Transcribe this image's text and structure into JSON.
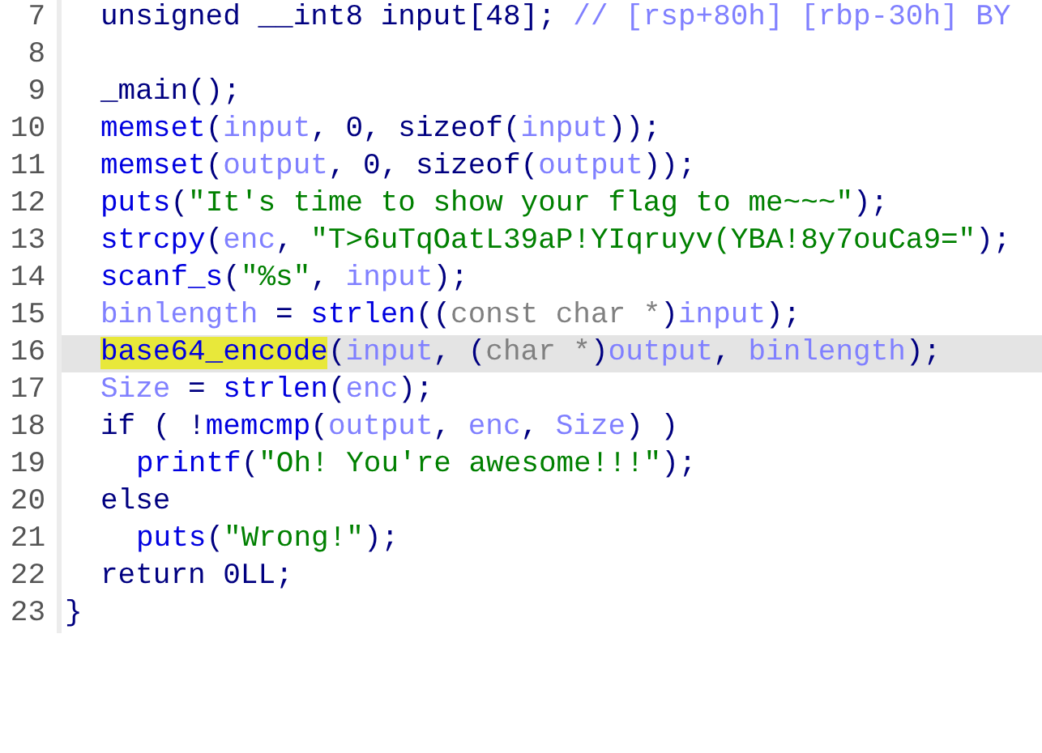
{
  "code_view": {
    "lines": [
      {
        "number": "7",
        "kind": "body",
        "current": false,
        "tokens": [
          {
            "kind": "plain",
            "text": "unsigned __int8 input[48]; "
          },
          {
            "kind": "comment",
            "text": "// [rsp+80h] [rbp-30h] BY"
          }
        ]
      },
      {
        "number": "8",
        "kind": "body",
        "current": false
      },
      {
        "number": "9",
        "kind": "body",
        "current": false,
        "tokens": [
          {
            "kind": "plain",
            "text": "_main();"
          }
        ]
      },
      {
        "number": "10",
        "kind": "body",
        "current": false,
        "tokens": [
          {
            "kind": "func",
            "text": "memset"
          },
          {
            "kind": "plain",
            "text": "("
          },
          {
            "kind": "var",
            "text": "input"
          },
          {
            "kind": "plain",
            "text": ", 0, sizeof("
          },
          {
            "kind": "var",
            "text": "input"
          },
          {
            "kind": "plain",
            "text": "));"
          }
        ]
      },
      {
        "number": "11",
        "kind": "body",
        "current": false,
        "tokens": [
          {
            "kind": "func",
            "text": "memset"
          },
          {
            "kind": "plain",
            "text": "("
          },
          {
            "kind": "var",
            "text": "output"
          },
          {
            "kind": "plain",
            "text": ", 0, sizeof("
          },
          {
            "kind": "var",
            "text": "output"
          },
          {
            "kind": "plain",
            "text": "));"
          }
        ]
      },
      {
        "number": "12",
        "kind": "body",
        "current": false,
        "tokens": [
          {
            "kind": "func",
            "text": "puts"
          },
          {
            "kind": "plain",
            "text": "("
          },
          {
            "kind": "string",
            "text": "\"It's time to show your flag to me~~~\""
          },
          {
            "kind": "plain",
            "text": ");"
          }
        ]
      },
      {
        "number": "13",
        "kind": "body",
        "current": false,
        "tokens": [
          {
            "kind": "func",
            "text": "strcpy"
          },
          {
            "kind": "plain",
            "text": "("
          },
          {
            "kind": "var",
            "text": "enc"
          },
          {
            "kind": "plain",
            "text": ", "
          },
          {
            "kind": "string",
            "text": "\"T>6uTqOatL39aP!YIqruyv(YBA!8y7ouCa9=\""
          },
          {
            "kind": "plain",
            "text": ");"
          }
        ]
      },
      {
        "number": "14",
        "kind": "body",
        "current": false,
        "tokens": [
          {
            "kind": "func",
            "text": "scanf_s"
          },
          {
            "kind": "plain",
            "text": "("
          },
          {
            "kind": "string",
            "text": "\"%s\""
          },
          {
            "kind": "plain",
            "text": ", "
          },
          {
            "kind": "var",
            "text": "input"
          },
          {
            "kind": "plain",
            "text": ");"
          }
        ]
      },
      {
        "number": "15",
        "kind": "body",
        "current": false,
        "tokens": [
          {
            "kind": "var",
            "text": "binlength"
          },
          {
            "kind": "plain",
            "text": " = "
          },
          {
            "kind": "func",
            "text": "strlen"
          },
          {
            "kind": "plain",
            "text": "(("
          },
          {
            "kind": "type",
            "text": "const char *"
          },
          {
            "kind": "plain",
            "text": ")"
          },
          {
            "kind": "var",
            "text": "input"
          },
          {
            "kind": "plain",
            "text": ");"
          }
        ]
      },
      {
        "number": "16",
        "kind": "body",
        "current": true,
        "tokens": [
          {
            "kind": "match",
            "text": "base64_encode"
          },
          {
            "kind": "plain",
            "text": "("
          },
          {
            "kind": "var",
            "text": "input"
          },
          {
            "kind": "plain",
            "text": ", ("
          },
          {
            "kind": "type",
            "text": "char *"
          },
          {
            "kind": "plain",
            "text": ")"
          },
          {
            "kind": "var",
            "text": "output"
          },
          {
            "kind": "plain",
            "text": ", "
          },
          {
            "kind": "var",
            "text": "binlength"
          },
          {
            "kind": "plain",
            "text": ");"
          }
        ]
      },
      {
        "number": "17",
        "kind": "body",
        "current": false,
        "tokens": [
          {
            "kind": "var",
            "text": "Size"
          },
          {
            "kind": "plain",
            "text": " = "
          },
          {
            "kind": "func",
            "text": "strlen"
          },
          {
            "kind": "plain",
            "text": "("
          },
          {
            "kind": "var",
            "text": "enc"
          },
          {
            "kind": "plain",
            "text": ");"
          }
        ]
      },
      {
        "number": "18",
        "kind": "body",
        "current": false,
        "tokens": [
          {
            "kind": "plain",
            "text": "if ( !"
          },
          {
            "kind": "func",
            "text": "memcmp"
          },
          {
            "kind": "plain",
            "text": "("
          },
          {
            "kind": "var",
            "text": "output"
          },
          {
            "kind": "plain",
            "text": ", "
          },
          {
            "kind": "var",
            "text": "enc"
          },
          {
            "kind": "plain",
            "text": ", "
          },
          {
            "kind": "var",
            "text": "Size"
          },
          {
            "kind": "plain",
            "text": ") )"
          }
        ]
      },
      {
        "number": "19",
        "kind": "nested",
        "current": false,
        "tokens": [
          {
            "kind": "func",
            "text": "printf"
          },
          {
            "kind": "plain",
            "text": "("
          },
          {
            "kind": "string",
            "text": "\"Oh! You're awesome!!!\""
          },
          {
            "kind": "plain",
            "text": ");"
          }
        ]
      },
      {
        "number": "20",
        "kind": "body",
        "current": false,
        "tokens": [
          {
            "kind": "plain",
            "text": "else"
          }
        ]
      },
      {
        "number": "21",
        "kind": "nested",
        "current": false,
        "tokens": [
          {
            "kind": "func",
            "text": "puts"
          },
          {
            "kind": "plain",
            "text": "("
          },
          {
            "kind": "string",
            "text": "\"Wrong!\""
          },
          {
            "kind": "plain",
            "text": ");"
          }
        ]
      },
      {
        "number": "22",
        "kind": "body",
        "current": false,
        "tokens": [
          {
            "kind": "plain",
            "text": "return 0LL;"
          }
        ]
      },
      {
        "number": "23",
        "kind": "top",
        "current": false,
        "tokens": [
          {
            "kind": "plain",
            "text": "}"
          }
        ]
      }
    ]
  }
}
